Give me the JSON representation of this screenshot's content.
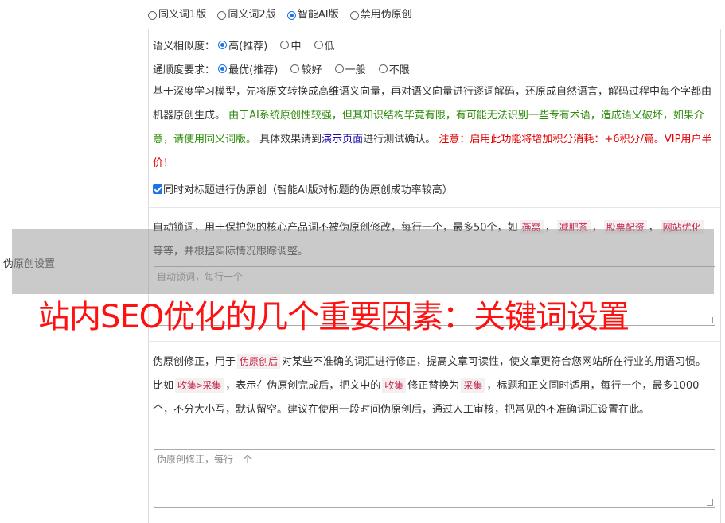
{
  "side_label": "伪原创设置",
  "version_options": [
    {
      "label": "同义词1版",
      "selected": false
    },
    {
      "label": "同义词2版",
      "selected": false
    },
    {
      "label": "智能AI版",
      "selected": true
    },
    {
      "label": "禁用伪原创",
      "selected": false
    }
  ],
  "similarity": {
    "label": "语义相似度：",
    "options": [
      {
        "label": "高(推荐)",
        "selected": true
      },
      {
        "label": "中",
        "selected": false
      },
      {
        "label": "低",
        "selected": false
      }
    ]
  },
  "fluency": {
    "label": "通顺度要求：",
    "options": [
      {
        "label": "最优(推荐)",
        "selected": true
      },
      {
        "label": "较好",
        "selected": false
      },
      {
        "label": "一般",
        "selected": false
      },
      {
        "label": "不限",
        "selected": false
      }
    ]
  },
  "description": {
    "part1": "基于深度学习模型，先将原文转换成高维语义向量，再对语义向量进行逐词解码，还原成自然语言，解码过程中每个字都由机器原创生成。",
    "green": "由于AI系统原创性较强，但其知识结构毕竟有限，有可能无法识别一些专有术语，造成语义破坏，如果介意，请使用同义词版。",
    "part2": "具体效果请到",
    "link": "演示页面",
    "part3": "进行测试确认。",
    "red": "注意：启用此功能将增加积分消耗：+6积分/篇。VIP用户半价！"
  },
  "title_option": {
    "label": "同时对标题进行伪原创（智能AI版对标题的伪原创成功率较高）",
    "checked": true
  },
  "lock_words": {
    "text1": "自动锁词，用于保护您的核心产品词不被伪原创修改，每行一个，最多50个，如",
    "examples": [
      "燕窝",
      "减肥茶",
      "股票配资",
      "网站优化"
    ],
    "text2": "等等，并根据实际情况跟踪调整。",
    "placeholder": "自动锁词，每行一个"
  },
  "correction": {
    "text1": "伪原创修正，用于",
    "tag1": "伪原创后",
    "text2": "对某些不准确的词汇进行修正，提高文章可读性，使文章更符合您网站所在行业的用语习惯。比如",
    "tag2": "收集>采集",
    "text3": "，表示在伪原创完成后，把文中的",
    "tag3": "收集",
    "text4": "修正替换为",
    "tag4": "采集",
    "text5": "，标题和正文同时适用，每行一个，最多1000个，不分大小写，默认留空。建议在使用一段时间伪原创后，通过人工审核，把常见的不准确词汇设置在此。",
    "placeholder": "伪原创修正，每行一个"
  },
  "overlay_title": "站内SEO优化的几个重要因素：关键词设置"
}
